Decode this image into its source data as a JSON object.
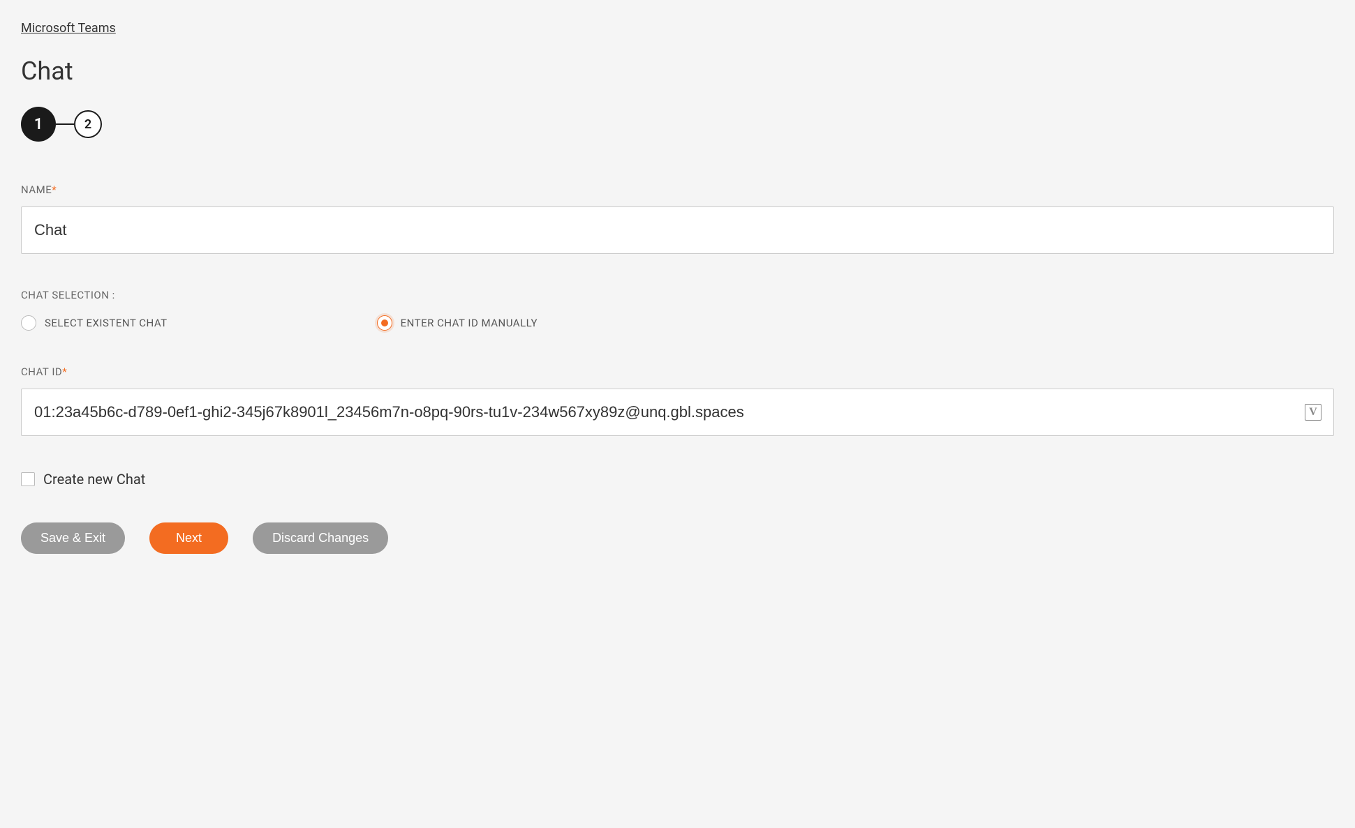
{
  "breadcrumb": "Microsoft Teams",
  "page_title": "Chat",
  "stepper": {
    "active": "1",
    "steps": [
      "1",
      "2"
    ]
  },
  "fields": {
    "name": {
      "label": "NAME",
      "required": "*",
      "value": "Chat"
    },
    "chat_selection": {
      "label": "CHAT SELECTION :",
      "options": {
        "existent": "SELECT EXISTENT CHAT",
        "manual": "ENTER CHAT ID MANUALLY"
      },
      "selected": "manual"
    },
    "chat_id": {
      "label": "CHAT ID",
      "required": "*",
      "value": "01:23a45b6c-d789-0ef1-ghi2-345j67k8901l_23456m7n-o8pq-90rs-tu1v-234w567xy89z@unq.gbl.spaces",
      "suffix_icon": "V"
    },
    "create_new": {
      "label": "Create new Chat",
      "checked": false
    }
  },
  "buttons": {
    "save_exit": "Save & Exit",
    "next": "Next",
    "discard": "Discard Changes"
  }
}
